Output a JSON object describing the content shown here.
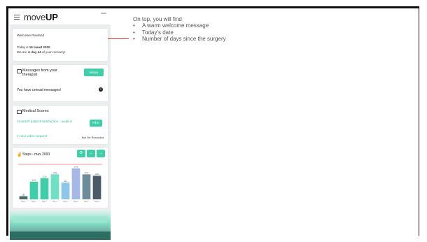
{
  "app": {
    "brand_prefix": "move",
    "brand_suffix": "UP"
  },
  "welcome": {
    "greeting": "Welcome Roeland",
    "date_prefix": "Today is ",
    "date_value": "16 maart 2020",
    "date_suffix": ".",
    "day_prefix": "We are at ",
    "day_value": "day 44",
    "day_suffix": " of your recovery!"
  },
  "messages": {
    "title": "Messages from your therapist",
    "history_button": "History",
    "unread_text": "You have unread messages!",
    "unread_count": "1"
  },
  "scores": {
    "title": "Medical Scores",
    "survey_label": "moveUP patient satisfaction - week 6",
    "fill_button": "Fill in",
    "video_request": "1 new video request",
    "video_status": "Not Yet Recorded"
  },
  "steps": {
    "icon": "footprints-icon",
    "title": "Steps - max 2000",
    "buttons": [
      "⟳",
      "←",
      "→"
    ]
  },
  "chart_data": {
    "type": "bar",
    "categories": [
      "Day 1",
      "Day 2",
      "Day 3",
      "Day 4",
      "Day 5",
      "Day 6",
      "Day 7",
      "Day 8"
    ],
    "values": [
      180,
      1010,
      1210,
      1430,
      961,
      1775,
      1427,
      1350
    ],
    "value_labels": [
      "180",
      "1010",
      "1210",
      "1430",
      "961",
      "1775",
      "1427",
      "1350"
    ],
    "ylim": [
      0,
      2000
    ],
    "target_line": 2000,
    "colors": [
      "#4a6a6c",
      "#3ecfa8",
      "#3ecfa8",
      "#6fe0c2",
      "#8cc6e8",
      "#a6b8e6",
      "#6c8c9c",
      "#4a5a68"
    ]
  },
  "annotation": {
    "heading": "On top, you will find",
    "bullets": [
      "A warm welcome message",
      "Today’s date",
      "Number of days since the surgery"
    ],
    "bullet_char": "•",
    "connector_color": "#d92b2b"
  }
}
